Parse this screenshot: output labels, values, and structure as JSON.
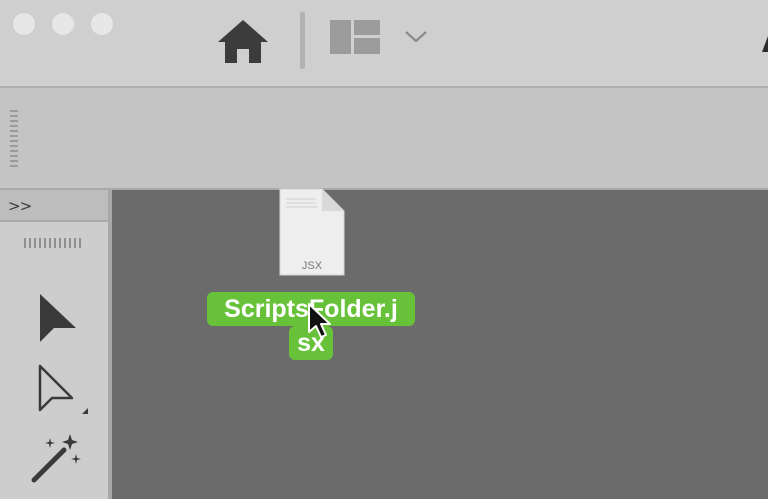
{
  "titlebar": {
    "buttons": [
      "close",
      "minimize",
      "zoom"
    ],
    "home_icon": "home-icon",
    "workspace_icon": "workspace-layout-icon",
    "chevron_icon": "chevron-down-icon"
  },
  "tools_panel": {
    "collapse_label": ">>",
    "tools": [
      {
        "name": "selection-tool",
        "icon": "arrow-cursor-icon"
      },
      {
        "name": "direct-selection-tool",
        "icon": "hollow-arrow-icon"
      },
      {
        "name": "magic-wand-tool",
        "icon": "magic-wand-icon"
      }
    ]
  },
  "drag_item": {
    "file_badge": "JSX",
    "filename_line1": "ScriptsFolder.j",
    "filename_line2": "sx",
    "label_color": "#67c23a"
  },
  "colors": {
    "titlebar_bg": "#cfcfcf",
    "controlbar_bg": "#c4c4c4",
    "panel_bg": "#cdcdcd",
    "canvas_bg": "#6b6b6b",
    "icon_dark": "#3c3c3c"
  }
}
